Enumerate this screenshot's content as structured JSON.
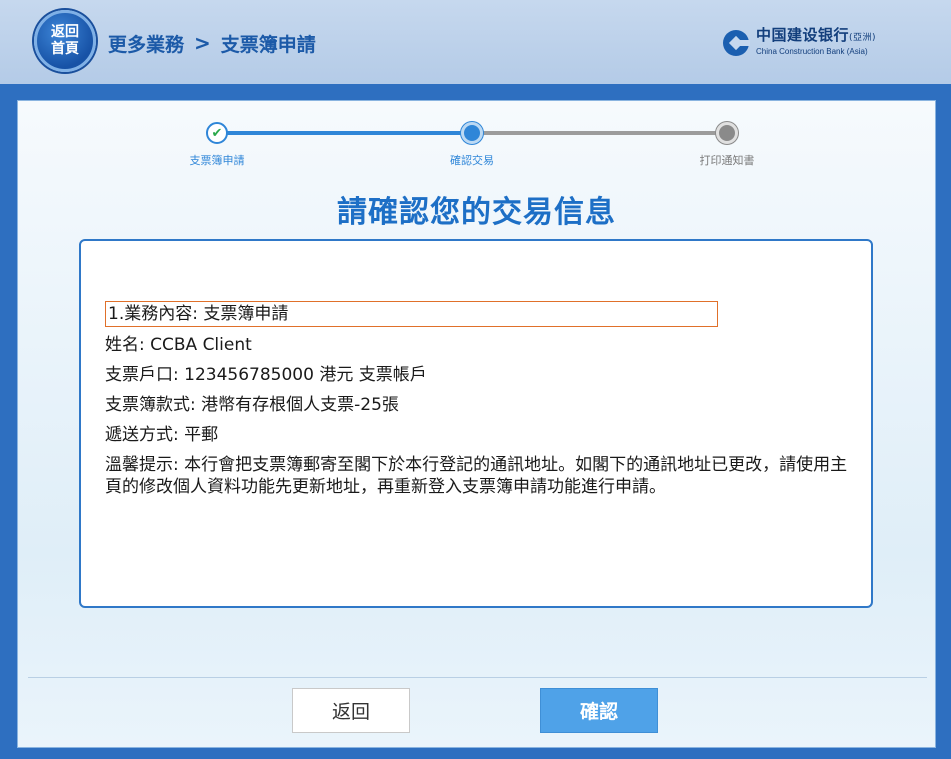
{
  "header": {
    "home_button": {
      "line1": "返回",
      "line2": "首頁"
    },
    "breadcrumb": {
      "parent": "更多業務",
      "separator": ">",
      "current": "支票簿申請"
    },
    "bank": {
      "name_cn": "中国建设银行",
      "name_suffix": "(亞洲)",
      "name_en": "China Construction Bank (Asia)"
    }
  },
  "stepper": {
    "steps": [
      {
        "label": "支票簿申請",
        "state": "done"
      },
      {
        "label": "確認交易",
        "state": "current"
      },
      {
        "label": "打印通知書",
        "state": "pending"
      }
    ]
  },
  "main": {
    "title": "請確認您的交易信息",
    "details": {
      "business": "1.業務內容:  支票簿申請",
      "name": "姓名:  CCBA Client",
      "account": "支票戶口:  123456785000 港元 支票帳戶",
      "chequebook_type": "支票簿款式:  港幣有存根個人支票-25張",
      "delivery": "遞送方式:  平郵",
      "notice": "溫馨提示:  本行會把支票簿郵寄至閣下於本行登記的通訊地址。如閣下的通訊地址已更改，請使用主頁的修改個人資料功能先更新地址，再重新登入支票簿申請功能進行申請。"
    }
  },
  "footer": {
    "back_label": "返回",
    "confirm_label": "確認"
  },
  "colors": {
    "primary": "#2f86d8",
    "title": "#1d6fc6",
    "highlight_border": "#e0702a"
  }
}
